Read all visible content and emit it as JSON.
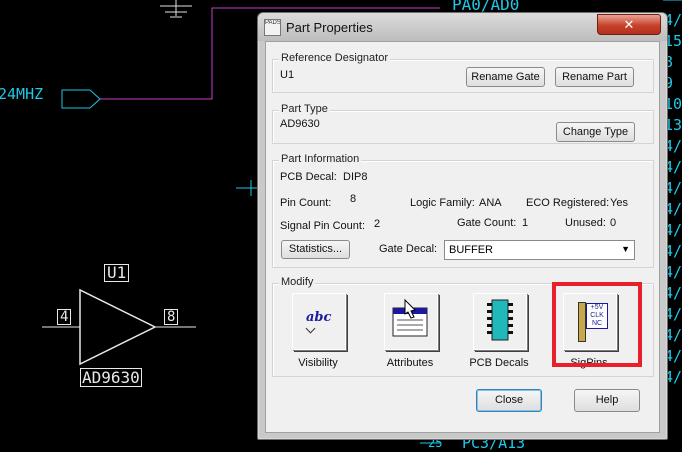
{
  "schematic": {
    "net_24mhz": "24MHZ",
    "net_top": "PA0/AD0",
    "net_bottom": "PC3/A13",
    "part_ref": "U1",
    "part_value": "AD9630",
    "pin_left": "4",
    "pin_right": "8",
    "right_chars": [
      "4/",
      "15",
      "8",
      "9",
      "10",
      "13",
      "4/",
      "4/",
      "4/",
      "4/",
      "4/",
      "4/",
      "4/",
      "4/",
      "4/",
      "4/",
      "4/",
      "4/"
    ],
    "bottom_num": "25"
  },
  "dialog": {
    "app_icon_text": "PADS",
    "title": "Part Properties",
    "close_glyph": "✕",
    "reference": {
      "label": "Reference Designator",
      "value": "U1",
      "rename_gate": "Rename Gate",
      "rename_part": "Rename Part"
    },
    "part_type": {
      "label": "Part Type",
      "value": "AD9630",
      "change_type": "Change Type"
    },
    "part_info": {
      "label": "Part Information",
      "pcb_decal_label": "PCB Decal:",
      "pcb_decal_value": "DIP8",
      "pin_count_label": "Pin Count:",
      "pin_count_value": "8",
      "logic_family_label": "Logic Family:",
      "logic_family_value": "ANA",
      "eco_label": "ECO Registered:",
      "eco_value": "Yes",
      "signal_pin_label": "Signal Pin Count:",
      "signal_pin_value": "2",
      "gate_count_label": "Gate Count:",
      "gate_count_value": "1",
      "unused_label": "Unused:",
      "unused_value": "0",
      "statistics": "Statistics...",
      "gate_decal_label": "Gate Decal:",
      "gate_decal_value": "BUFFER"
    },
    "modify": {
      "label": "Modify",
      "visibility": "Visibility",
      "visibility_icon_text": "abc",
      "attributes": "Attributes",
      "pcb_decals": "PCB Decals",
      "sigpins": "SigPins",
      "sigpins_icon_lines": [
        "+5V",
        "CLK",
        "NC"
      ]
    },
    "close": "Close",
    "help": "Help"
  },
  "colors": {
    "highlight": "#e8202a",
    "net_cyan": "#1ec8e8",
    "wire_magenta": "#c83cc8",
    "dialog_bg": "#f0f0f0"
  }
}
